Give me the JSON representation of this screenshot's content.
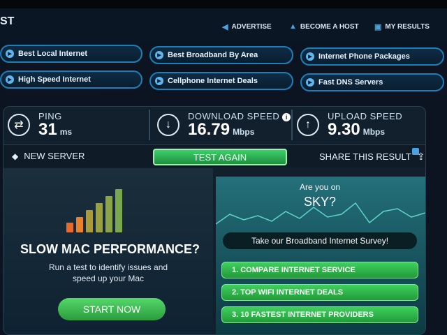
{
  "header": {
    "brand": "ST",
    "links": [
      {
        "icon": "megaphone-icon",
        "label": "ADVERTISE"
      },
      {
        "icon": "upload-icon",
        "label": "BECOME A HOST"
      },
      {
        "icon": "results-icon",
        "label": "MY RESULTS"
      }
    ]
  },
  "quick_links": [
    "Best Local Internet",
    "Best Broadband By Area",
    "Internet Phone Packages",
    "High Speed Internet",
    "Cellphone Internet Deals",
    "Fast DNS Servers"
  ],
  "metrics": {
    "ping": {
      "label": "PING",
      "value": "31",
      "unit": "ms"
    },
    "download": {
      "label": "DOWNLOAD SPEED",
      "value": "16.79",
      "unit": "Mbps"
    },
    "upload": {
      "label": "UPLOAD SPEED",
      "value": "9.30",
      "unit": "Mbps"
    }
  },
  "actions": {
    "new_server": "NEW SERVER",
    "test_again": "TEST AGAIN",
    "share": "SHARE THIS RESULT"
  },
  "ad_left": {
    "headline": "SLOW MAC PERFORMANCE?",
    "subtext": "Run a test to identify issues and speed up your Mac",
    "cta": "START NOW"
  },
  "ad_right": {
    "question": "Are you on",
    "provider": "SKY?",
    "survey": "Take our Broadband Internet Survey!",
    "buttons": [
      "1. COMPARE INTERNET SERVICE",
      "2. TOP WIFI INTERNET DEALS",
      "3. 10 FASTEST INTERNET PROVIDERS"
    ]
  }
}
